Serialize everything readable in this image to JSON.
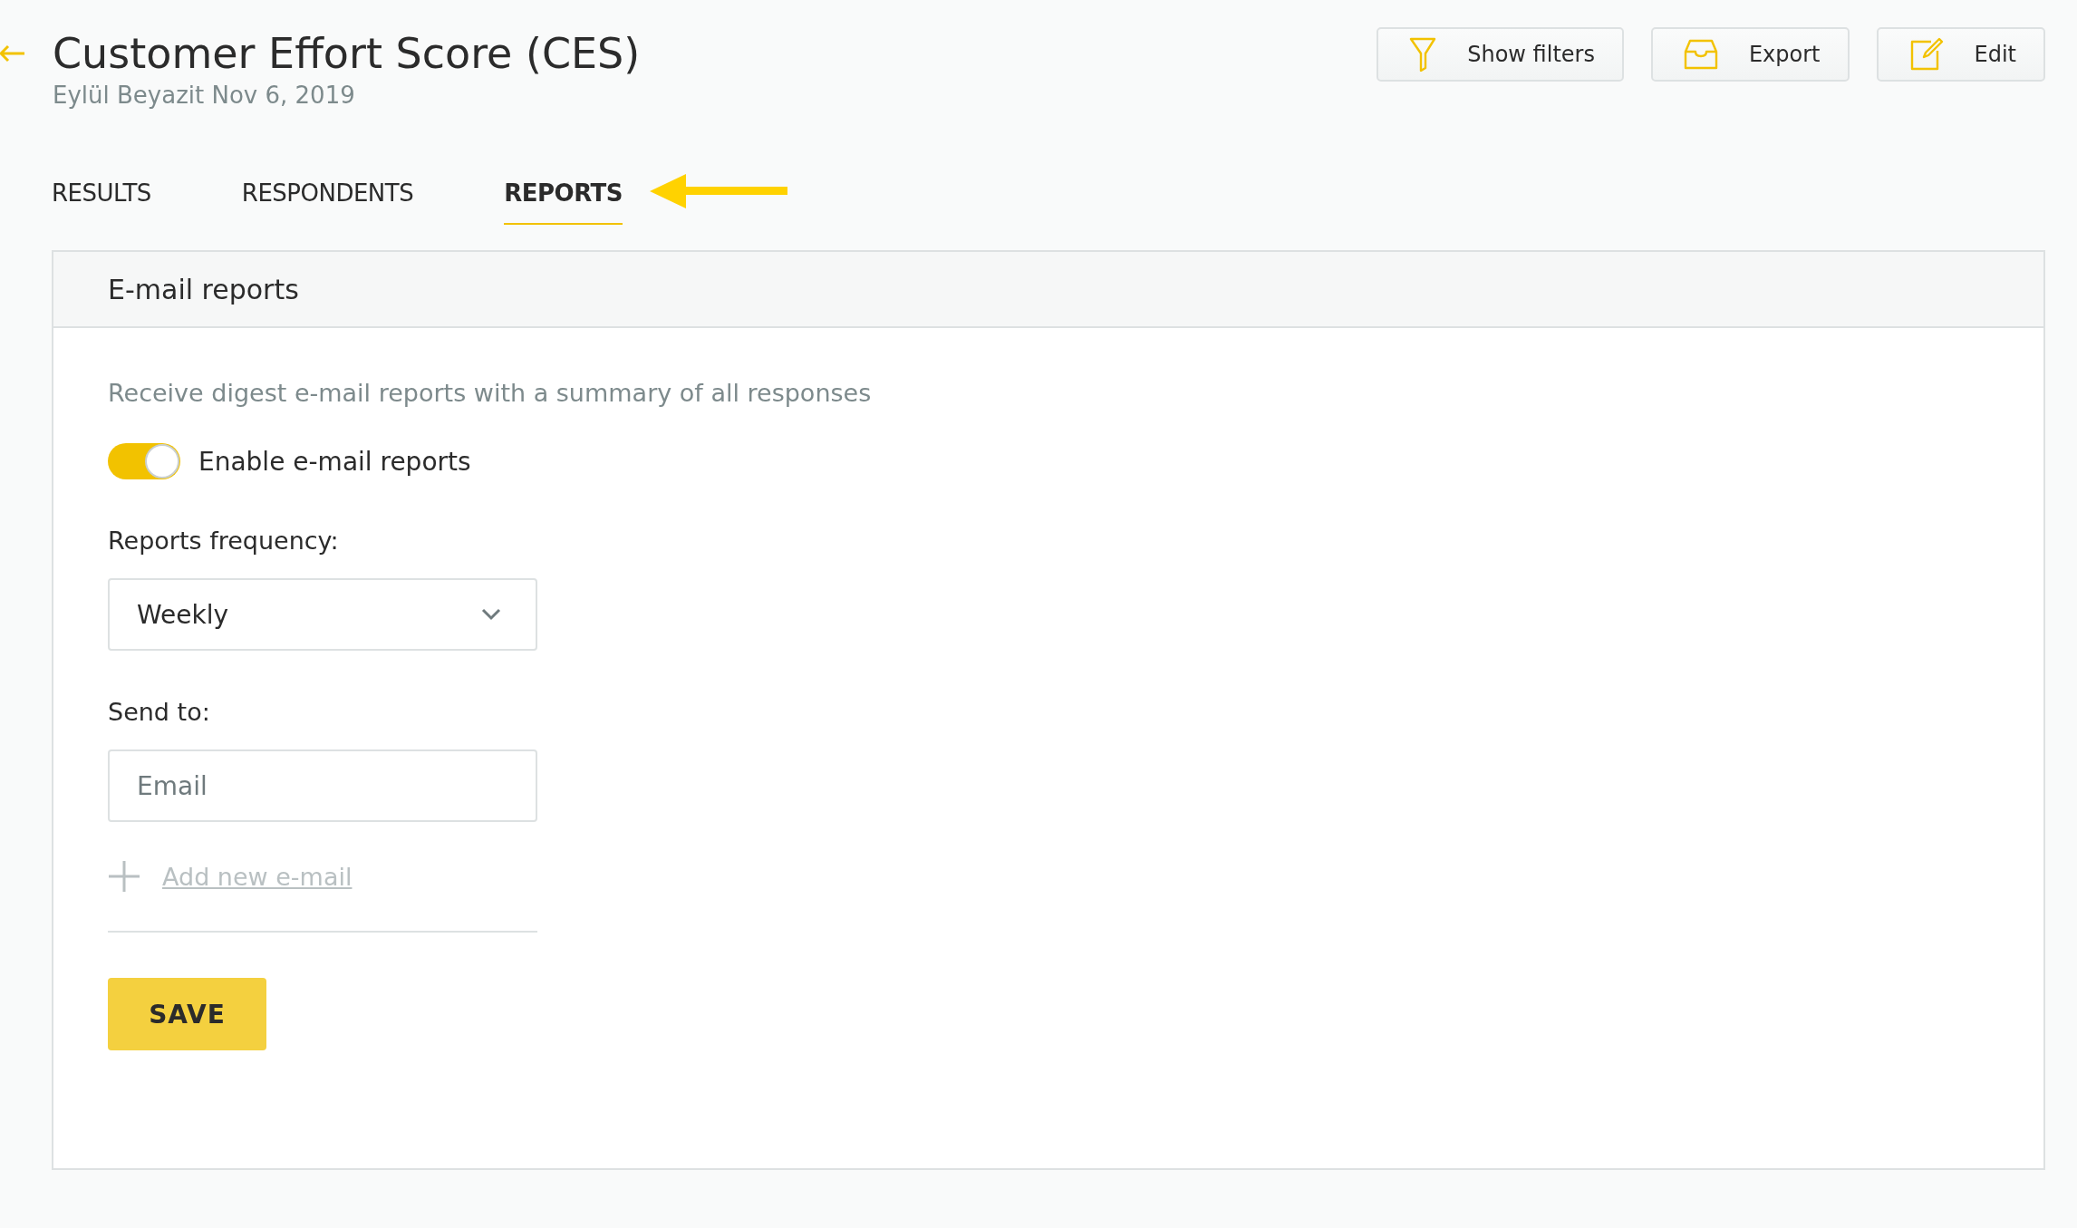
{
  "header": {
    "title": "Customer Effort Score (CES)",
    "subtitle": "Eylül Beyazit Nov 6, 2019"
  },
  "actions": [
    {
      "kind": "filter",
      "label": "Show filters"
    },
    {
      "kind": "inbox",
      "label": "Export"
    },
    {
      "kind": "edit",
      "label": "Edit"
    }
  ],
  "tabs": [
    {
      "label": "RESULTS",
      "selected": false
    },
    {
      "label": "RESPONDENTS",
      "selected": false
    },
    {
      "label": "REPORTS",
      "selected": true
    }
  ],
  "card": {
    "title": "E-mail reports",
    "description": "Receive digest e-mail reports with a summary of all responses",
    "toggle": {
      "label": "Enable e-mail reports",
      "on": true
    },
    "frequency": {
      "label": "Reports frequency:",
      "value": "Weekly"
    },
    "send_to": {
      "label": "Send to:",
      "placeholder": "Email"
    },
    "add_link": "Add new e-mail",
    "save": "SAVE"
  }
}
